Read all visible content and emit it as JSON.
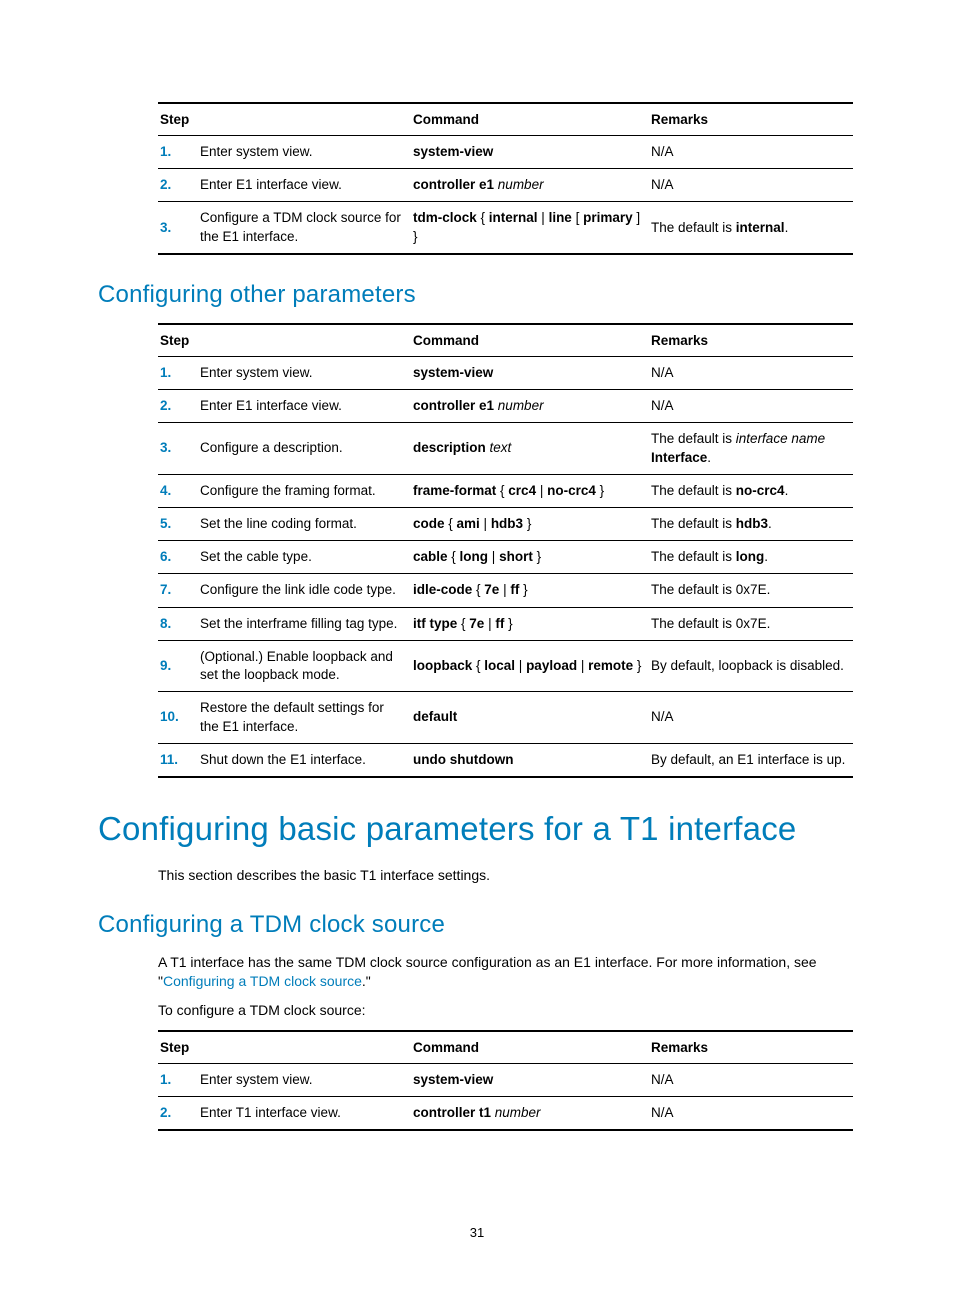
{
  "page_number": "31",
  "table1": {
    "headers": {
      "step": "Step",
      "command": "Command",
      "remarks": "Remarks"
    },
    "rows": [
      {
        "n": "1.",
        "step": "Enter system view.",
        "cmd": [
          {
            "b": "system-view"
          }
        ],
        "rem": [
          {
            "t": "N/A"
          }
        ]
      },
      {
        "n": "2.",
        "step": "Enter E1 interface view.",
        "cmd": [
          {
            "b": "controller e1"
          },
          {
            "t": " "
          },
          {
            "i": "number"
          }
        ],
        "rem": [
          {
            "t": "N/A"
          }
        ]
      },
      {
        "n": "3.",
        "step": "Configure a TDM clock source for the E1 interface.",
        "cmd": [
          {
            "b": "tdm-clock"
          },
          {
            "t": " { "
          },
          {
            "b": "internal"
          },
          {
            "t": " | "
          },
          {
            "b": "line"
          },
          {
            "t": " [ "
          },
          {
            "b": "primary"
          },
          {
            "t": " ] }"
          }
        ],
        "rem": [
          {
            "t": "The default is "
          },
          {
            "b": "internal"
          },
          {
            "t": "."
          }
        ]
      }
    ]
  },
  "h2_other": "Configuring other parameters",
  "table2": {
    "headers": {
      "step": "Step",
      "command": "Command",
      "remarks": "Remarks"
    },
    "rows": [
      {
        "n": "1.",
        "step": "Enter system view.",
        "cmd": [
          {
            "b": "system-view"
          }
        ],
        "rem": [
          {
            "t": "N/A"
          }
        ]
      },
      {
        "n": "2.",
        "step": "Enter E1 interface view.",
        "cmd": [
          {
            "b": "controller e1"
          },
          {
            "t": " "
          },
          {
            "i": "number"
          }
        ],
        "rem": [
          {
            "t": "N/A"
          }
        ]
      },
      {
        "n": "3.",
        "step": "Configure a description.",
        "cmd": [
          {
            "b": "description"
          },
          {
            "t": " "
          },
          {
            "i": "text"
          }
        ],
        "rem": [
          {
            "t": "The default is "
          },
          {
            "i": "interface name"
          },
          {
            "t": " "
          },
          {
            "b": "Interface"
          },
          {
            "t": "."
          }
        ]
      },
      {
        "n": "4.",
        "step": "Configure the framing format.",
        "cmd": [
          {
            "b": "frame-format"
          },
          {
            "t": " { "
          },
          {
            "b": "crc4"
          },
          {
            "t": " | "
          },
          {
            "b": "no-crc4"
          },
          {
            "t": " }"
          }
        ],
        "rem": [
          {
            "t": "The default is "
          },
          {
            "b": "no-crc4"
          },
          {
            "t": "."
          }
        ]
      },
      {
        "n": "5.",
        "step": "Set the line coding format.",
        "cmd": [
          {
            "b": "code"
          },
          {
            "t": " { "
          },
          {
            "b": "ami"
          },
          {
            "t": " | "
          },
          {
            "b": "hdb3"
          },
          {
            "t": " }"
          }
        ],
        "rem": [
          {
            "t": "The default is "
          },
          {
            "b": "hdb3"
          },
          {
            "t": "."
          }
        ]
      },
      {
        "n": "6.",
        "step": "Set the cable type.",
        "cmd": [
          {
            "b": "cable"
          },
          {
            "t": " { "
          },
          {
            "b": "long"
          },
          {
            "t": " | "
          },
          {
            "b": "short"
          },
          {
            "t": " }"
          }
        ],
        "rem": [
          {
            "t": "The default is "
          },
          {
            "b": "long"
          },
          {
            "t": "."
          }
        ]
      },
      {
        "n": "7.",
        "step": "Configure the link idle code type.",
        "cmd": [
          {
            "b": "idle-code"
          },
          {
            "t": " { "
          },
          {
            "b": "7e"
          },
          {
            "t": " | "
          },
          {
            "b": "ff"
          },
          {
            "t": " }"
          }
        ],
        "rem": [
          {
            "t": "The default is 0x7E."
          }
        ]
      },
      {
        "n": "8.",
        "step": "Set the interframe filling tag type.",
        "cmd": [
          {
            "b": "itf type"
          },
          {
            "t": " { "
          },
          {
            "b": "7e"
          },
          {
            "t": " | "
          },
          {
            "b": "ff"
          },
          {
            "t": " }"
          }
        ],
        "rem": [
          {
            "t": "The default is 0x7E."
          }
        ]
      },
      {
        "n": "9.",
        "step": "(Optional.) Enable loopback and set the loopback mode.",
        "cmd": [
          {
            "b": "loopback"
          },
          {
            "t": " { "
          },
          {
            "b": "local"
          },
          {
            "t": " | "
          },
          {
            "b": "payload"
          },
          {
            "t": " | "
          },
          {
            "b": "remote"
          },
          {
            "t": " }"
          }
        ],
        "rem": [
          {
            "t": "By default, loopback is disabled."
          }
        ]
      },
      {
        "n": "10.",
        "step": "Restore the default settings for the E1 interface.",
        "cmd": [
          {
            "b": "default"
          }
        ],
        "rem": [
          {
            "t": "N/A"
          }
        ]
      },
      {
        "n": "11.",
        "step": "Shut down the E1 interface.",
        "cmd": [
          {
            "b": "undo shutdown"
          }
        ],
        "rem": [
          {
            "t": "By default, an E1 interface is up."
          }
        ]
      }
    ]
  },
  "h1_t1": "Configuring basic parameters for a T1 interface",
  "p_t1_intro": "This section describes the basic T1 interface settings.",
  "h2_tdm": "Configuring a TDM clock source",
  "p_tdm_1_a": "A T1 interface has the same TDM clock source configuration as an E1 interface. For more information, see \"",
  "p_tdm_1_link": "Configuring a TDM clock source",
  "p_tdm_1_b": ".\"",
  "p_tdm_2": "To configure a TDM clock source:",
  "table3": {
    "headers": {
      "step": "Step",
      "command": "Command",
      "remarks": "Remarks"
    },
    "rows": [
      {
        "n": "1.",
        "step": "Enter system view.",
        "cmd": [
          {
            "b": "system-view"
          }
        ],
        "rem": [
          {
            "t": "N/A"
          }
        ]
      },
      {
        "n": "2.",
        "step": "Enter T1 interface view.",
        "cmd": [
          {
            "b": "controller t1"
          },
          {
            "t": " "
          },
          {
            "i": "number"
          }
        ],
        "rem": [
          {
            "t": "N/A"
          }
        ]
      }
    ]
  }
}
